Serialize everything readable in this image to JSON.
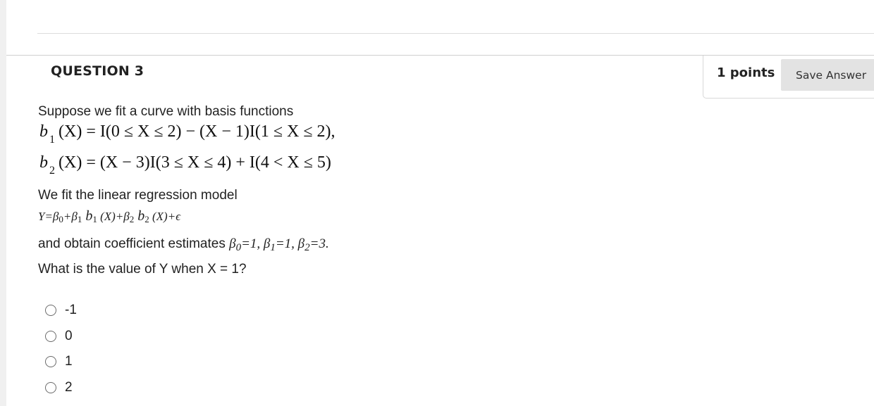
{
  "question": {
    "title": "QUESTION 3",
    "points": "1 points",
    "save_label": "Save Answer",
    "intro": "Suppose we fit a curve with basis functions",
    "basis": {
      "b1": {
        "name": "b",
        "sub": "1",
        "rhs": "(X) = I(0 ≤ X ≤ 2) − (X − 1)I(1 ≤ X ≤ 2),"
      },
      "b2": {
        "name": "b",
        "sub": "2",
        "rhs": "(X) = (X − 3)I(3 ≤ X ≤ 4) + I(4 < X ≤ 5)"
      }
    },
    "model_intro": "We fit the linear regression model",
    "model": {
      "y": "Y=β",
      "s0": "0",
      "plus1": "+β",
      "s1": "1",
      "b1": " b",
      "b1s": "1",
      "mid": " (X)+β",
      "s2": "2",
      "b2": " b",
      "b2s": "2",
      "end": " (X)+ϵ"
    },
    "estimates_intro": "and obtain coefficient estimates ",
    "estimates": {
      "p0": "β",
      "s0": "0",
      "v0": "=1, β",
      "s1": "1",
      "v1": "=1, β",
      "s2": "2",
      "v2": "=3."
    },
    "prompt": "What is the value of Y when X = 1?",
    "options": [
      "-1",
      "0",
      "1",
      "2"
    ]
  }
}
